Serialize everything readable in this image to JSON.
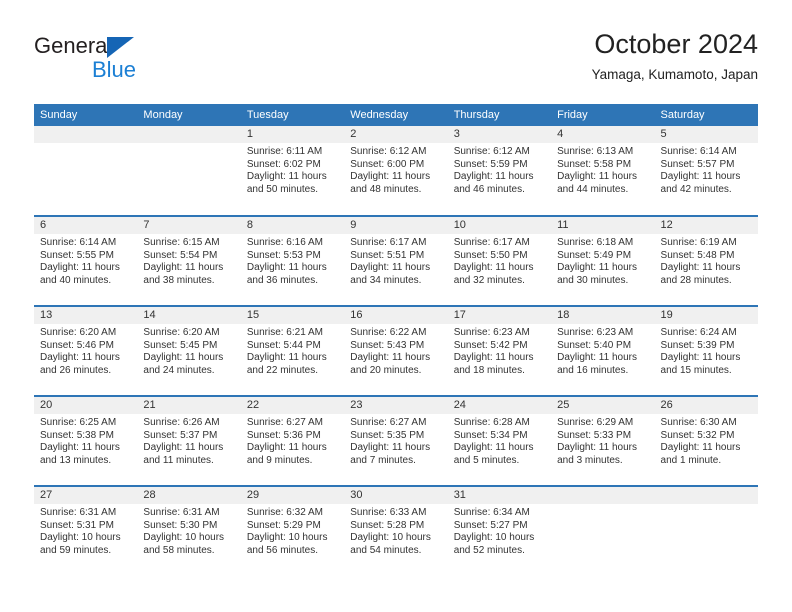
{
  "brand": {
    "name_top": "General",
    "name_bottom": "Blue",
    "triangle_color": "#1565b5",
    "blue_text_color": "#1b7fd4"
  },
  "header": {
    "title": "October 2024",
    "subtitle": "Yamaga, Kumamoto, Japan"
  },
  "theme": {
    "header_bg": "#2e75b6",
    "header_text": "#ffffff",
    "daynum_bg": "#f0f0f0",
    "body_text": "#333333"
  },
  "weekday_headers": [
    "Sunday",
    "Monday",
    "Tuesday",
    "Wednesday",
    "Thursday",
    "Friday",
    "Saturday"
  ],
  "weeks": [
    [
      {
        "day": "",
        "sunrise": "",
        "sunset": "",
        "daylight_line1": "",
        "daylight_line2": ""
      },
      {
        "day": "",
        "sunrise": "",
        "sunset": "",
        "daylight_line1": "",
        "daylight_line2": ""
      },
      {
        "day": "1",
        "sunrise": "Sunrise: 6:11 AM",
        "sunset": "Sunset: 6:02 PM",
        "daylight_line1": "Daylight: 11 hours",
        "daylight_line2": "and 50 minutes."
      },
      {
        "day": "2",
        "sunrise": "Sunrise: 6:12 AM",
        "sunset": "Sunset: 6:00 PM",
        "daylight_line1": "Daylight: 11 hours",
        "daylight_line2": "and 48 minutes."
      },
      {
        "day": "3",
        "sunrise": "Sunrise: 6:12 AM",
        "sunset": "Sunset: 5:59 PM",
        "daylight_line1": "Daylight: 11 hours",
        "daylight_line2": "and 46 minutes."
      },
      {
        "day": "4",
        "sunrise": "Sunrise: 6:13 AM",
        "sunset": "Sunset: 5:58 PM",
        "daylight_line1": "Daylight: 11 hours",
        "daylight_line2": "and 44 minutes."
      },
      {
        "day": "5",
        "sunrise": "Sunrise: 6:14 AM",
        "sunset": "Sunset: 5:57 PM",
        "daylight_line1": "Daylight: 11 hours",
        "daylight_line2": "and 42 minutes."
      }
    ],
    [
      {
        "day": "6",
        "sunrise": "Sunrise: 6:14 AM",
        "sunset": "Sunset: 5:55 PM",
        "daylight_line1": "Daylight: 11 hours",
        "daylight_line2": "and 40 minutes."
      },
      {
        "day": "7",
        "sunrise": "Sunrise: 6:15 AM",
        "sunset": "Sunset: 5:54 PM",
        "daylight_line1": "Daylight: 11 hours",
        "daylight_line2": "and 38 minutes."
      },
      {
        "day": "8",
        "sunrise": "Sunrise: 6:16 AM",
        "sunset": "Sunset: 5:53 PM",
        "daylight_line1": "Daylight: 11 hours",
        "daylight_line2": "and 36 minutes."
      },
      {
        "day": "9",
        "sunrise": "Sunrise: 6:17 AM",
        "sunset": "Sunset: 5:51 PM",
        "daylight_line1": "Daylight: 11 hours",
        "daylight_line2": "and 34 minutes."
      },
      {
        "day": "10",
        "sunrise": "Sunrise: 6:17 AM",
        "sunset": "Sunset: 5:50 PM",
        "daylight_line1": "Daylight: 11 hours",
        "daylight_line2": "and 32 minutes."
      },
      {
        "day": "11",
        "sunrise": "Sunrise: 6:18 AM",
        "sunset": "Sunset: 5:49 PM",
        "daylight_line1": "Daylight: 11 hours",
        "daylight_line2": "and 30 minutes."
      },
      {
        "day": "12",
        "sunrise": "Sunrise: 6:19 AM",
        "sunset": "Sunset: 5:48 PM",
        "daylight_line1": "Daylight: 11 hours",
        "daylight_line2": "and 28 minutes."
      }
    ],
    [
      {
        "day": "13",
        "sunrise": "Sunrise: 6:20 AM",
        "sunset": "Sunset: 5:46 PM",
        "daylight_line1": "Daylight: 11 hours",
        "daylight_line2": "and 26 minutes."
      },
      {
        "day": "14",
        "sunrise": "Sunrise: 6:20 AM",
        "sunset": "Sunset: 5:45 PM",
        "daylight_line1": "Daylight: 11 hours",
        "daylight_line2": "and 24 minutes."
      },
      {
        "day": "15",
        "sunrise": "Sunrise: 6:21 AM",
        "sunset": "Sunset: 5:44 PM",
        "daylight_line1": "Daylight: 11 hours",
        "daylight_line2": "and 22 minutes."
      },
      {
        "day": "16",
        "sunrise": "Sunrise: 6:22 AM",
        "sunset": "Sunset: 5:43 PM",
        "daylight_line1": "Daylight: 11 hours",
        "daylight_line2": "and 20 minutes."
      },
      {
        "day": "17",
        "sunrise": "Sunrise: 6:23 AM",
        "sunset": "Sunset: 5:42 PM",
        "daylight_line1": "Daylight: 11 hours",
        "daylight_line2": "and 18 minutes."
      },
      {
        "day": "18",
        "sunrise": "Sunrise: 6:23 AM",
        "sunset": "Sunset: 5:40 PM",
        "daylight_line1": "Daylight: 11 hours",
        "daylight_line2": "and 16 minutes."
      },
      {
        "day": "19",
        "sunrise": "Sunrise: 6:24 AM",
        "sunset": "Sunset: 5:39 PM",
        "daylight_line1": "Daylight: 11 hours",
        "daylight_line2": "and 15 minutes."
      }
    ],
    [
      {
        "day": "20",
        "sunrise": "Sunrise: 6:25 AM",
        "sunset": "Sunset: 5:38 PM",
        "daylight_line1": "Daylight: 11 hours",
        "daylight_line2": "and 13 minutes."
      },
      {
        "day": "21",
        "sunrise": "Sunrise: 6:26 AM",
        "sunset": "Sunset: 5:37 PM",
        "daylight_line1": "Daylight: 11 hours",
        "daylight_line2": "and 11 minutes."
      },
      {
        "day": "22",
        "sunrise": "Sunrise: 6:27 AM",
        "sunset": "Sunset: 5:36 PM",
        "daylight_line1": "Daylight: 11 hours",
        "daylight_line2": "and 9 minutes."
      },
      {
        "day": "23",
        "sunrise": "Sunrise: 6:27 AM",
        "sunset": "Sunset: 5:35 PM",
        "daylight_line1": "Daylight: 11 hours",
        "daylight_line2": "and 7 minutes."
      },
      {
        "day": "24",
        "sunrise": "Sunrise: 6:28 AM",
        "sunset": "Sunset: 5:34 PM",
        "daylight_line1": "Daylight: 11 hours",
        "daylight_line2": "and 5 minutes."
      },
      {
        "day": "25",
        "sunrise": "Sunrise: 6:29 AM",
        "sunset": "Sunset: 5:33 PM",
        "daylight_line1": "Daylight: 11 hours",
        "daylight_line2": "and 3 minutes."
      },
      {
        "day": "26",
        "sunrise": "Sunrise: 6:30 AM",
        "sunset": "Sunset: 5:32 PM",
        "daylight_line1": "Daylight: 11 hours",
        "daylight_line2": "and 1 minute."
      }
    ],
    [
      {
        "day": "27",
        "sunrise": "Sunrise: 6:31 AM",
        "sunset": "Sunset: 5:31 PM",
        "daylight_line1": "Daylight: 10 hours",
        "daylight_line2": "and 59 minutes."
      },
      {
        "day": "28",
        "sunrise": "Sunrise: 6:31 AM",
        "sunset": "Sunset: 5:30 PM",
        "daylight_line1": "Daylight: 10 hours",
        "daylight_line2": "and 58 minutes."
      },
      {
        "day": "29",
        "sunrise": "Sunrise: 6:32 AM",
        "sunset": "Sunset: 5:29 PM",
        "daylight_line1": "Daylight: 10 hours",
        "daylight_line2": "and 56 minutes."
      },
      {
        "day": "30",
        "sunrise": "Sunrise: 6:33 AM",
        "sunset": "Sunset: 5:28 PM",
        "daylight_line1": "Daylight: 10 hours",
        "daylight_line2": "and 54 minutes."
      },
      {
        "day": "31",
        "sunrise": "Sunrise: 6:34 AM",
        "sunset": "Sunset: 5:27 PM",
        "daylight_line1": "Daylight: 10 hours",
        "daylight_line2": "and 52 minutes."
      },
      {
        "day": "",
        "sunrise": "",
        "sunset": "",
        "daylight_line1": "",
        "daylight_line2": ""
      },
      {
        "day": "",
        "sunrise": "",
        "sunset": "",
        "daylight_line1": "",
        "daylight_line2": ""
      }
    ]
  ]
}
